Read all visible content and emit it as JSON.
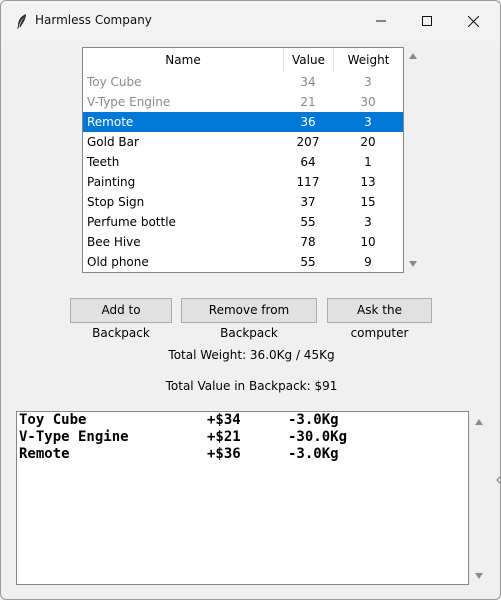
{
  "window": {
    "title": "Harmless Company",
    "app_icon": "feather-icon"
  },
  "table": {
    "columns": [
      "Name",
      "Value",
      "Weight"
    ],
    "rows": [
      {
        "name": "Toy Cube",
        "value": "34",
        "weight": "3",
        "state": "disabled"
      },
      {
        "name": "V-Type Engine",
        "value": "21",
        "weight": "30",
        "state": "disabled"
      },
      {
        "name": "Remote",
        "value": "36",
        "weight": "3",
        "state": "selected"
      },
      {
        "name": "Gold Bar",
        "value": "207",
        "weight": "20",
        "state": "normal"
      },
      {
        "name": "Teeth",
        "value": "64",
        "weight": "1",
        "state": "normal"
      },
      {
        "name": "Painting",
        "value": "117",
        "weight": "13",
        "state": "normal"
      },
      {
        "name": "Stop Sign",
        "value": "37",
        "weight": "15",
        "state": "normal"
      },
      {
        "name": "Perfume bottle",
        "value": "55",
        "weight": "3",
        "state": "normal"
      },
      {
        "name": "Bee Hive",
        "value": "78",
        "weight": "10",
        "state": "normal"
      },
      {
        "name": "Old phone",
        "value": "55",
        "weight": "9",
        "state": "normal"
      }
    ]
  },
  "buttons": {
    "add": "Add to Backpack",
    "remove": "Remove from Backpack",
    "ask": "Ask the computer"
  },
  "status": {
    "total_weight": "Total Weight: 36.0Kg / 45Kg",
    "total_value": "Total Value in Backpack: $91"
  },
  "log": {
    "lines": [
      {
        "item": "Toy Cube",
        "value": "+$34",
        "weight": "-3.0Kg"
      },
      {
        "item": "V-Type Engine",
        "value": "+$21",
        "weight": "-30.0Kg"
      },
      {
        "item": "Remote",
        "value": "+$36",
        "weight": "-3.0Kg"
      }
    ]
  },
  "colors": {
    "selection": "#0078d7",
    "disabled_text": "#8a8a8a"
  }
}
